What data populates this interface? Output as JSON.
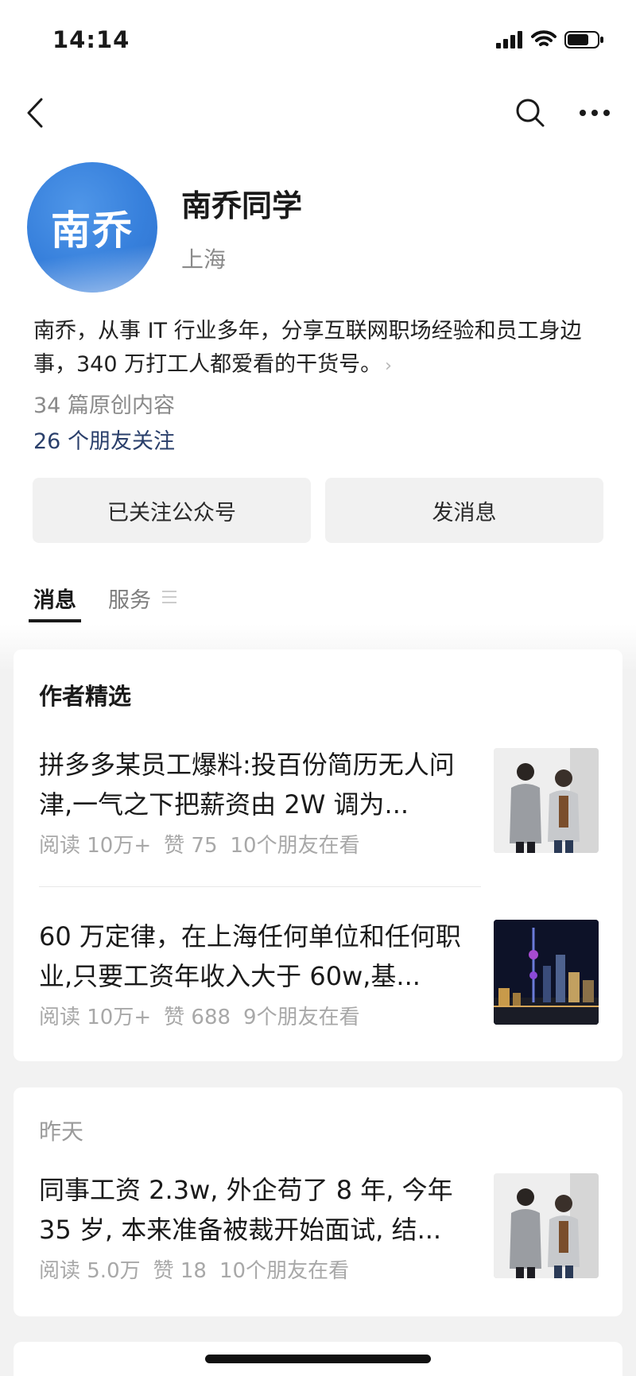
{
  "status": {
    "time": "14:14"
  },
  "account": {
    "avatar_text": "南乔",
    "name": "南乔同学",
    "location": "上海",
    "description": "南乔，从事 IT 行业多年，分享互联网职场经验和员工身边事，340 万打工人都爱看的干货号。",
    "original_count": "34 篇原创内容",
    "friends_following": "26 个朋友关注"
  },
  "actions": {
    "followed": "已关注公众号",
    "message": "发消息"
  },
  "tabs": {
    "messages": "消息",
    "services": "服务"
  },
  "featured": {
    "heading": "作者精选",
    "articles": [
      {
        "title": "拼多多某员工爆料:投百份简历无人问津,一气之下把薪资由 2W 调为...",
        "reads": "阅读 10万+",
        "likes": "赞 75",
        "friends": "10个朋友在看",
        "thumb": "office-photo"
      },
      {
        "title": "60 万定律，在上海任何单位和任何职业,只要工资年收入大于 60w,基...",
        "reads": "阅读 10万+",
        "likes": "赞 688",
        "friends": "9个朋友在看",
        "thumb": "city-night-photo"
      }
    ]
  },
  "recent": {
    "date": "昨天",
    "articles": [
      {
        "title": "同事工资 2.3w, 外企苟了 8 年, 今年 35 岁, 本来准备被裁开始面试, 结...",
        "reads": "阅读 5.0万",
        "likes": "赞 18",
        "friends": "10个朋友在看",
        "thumb": "office-photo"
      }
    ]
  }
}
